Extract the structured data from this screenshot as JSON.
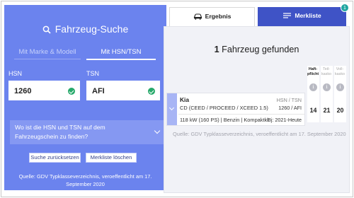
{
  "search": {
    "title": "Fahrzeug-Suche",
    "mode_tabs": [
      "Mit Marke & Modell",
      "Mit HSN/TSN"
    ],
    "active_mode": "Mit HSN/TSN",
    "hsn_label": "HSN",
    "hsn_value": "1260",
    "tsn_label": "TSN",
    "tsn_value": "AFI",
    "faq_text": "Wo ist die HSN und TSN auf dem Fahrzeugschein zu finden?",
    "reset_button": "Suche zurücksetzen",
    "clear_button": "Merkliste löschen",
    "source_note": "Quelle: GDV Typklasseverzeichnis, veroeffentlicht am 17. September 2020"
  },
  "tabs": {
    "result_label": "Ergebnis",
    "watchlist_label": "Merkliste",
    "watchlist_count": "1"
  },
  "result": {
    "count_number": "1",
    "count_text": "Fahrzeug gefunden",
    "columns": [
      {
        "label": "Haft-pflicht",
        "active": true
      },
      {
        "label": "Teil-kasko",
        "active": false
      },
      {
        "label": "Voll-kasko",
        "active": false
      }
    ],
    "info_glyph": "i",
    "vehicle": {
      "make": "Kia",
      "model": "CD (CEED / PROCEED / XCEED 1.5)",
      "hsn_tsn_label": "HSN / TSN",
      "hsn_tsn_value": "1260 / AFI",
      "specs": "118 kW (160 PS) | Benzin | Kompaktkl",
      "build_years": "Bj: 2021-Heute",
      "scores": [
        "14",
        "21",
        "20"
      ]
    },
    "source_note": "Quelle: GDV Typklasseverzeichnis, veroeffentlicht am 17. September 2020"
  },
  "colors": {
    "left_panel": "#6b83ee",
    "watchlist_tab": "#3f53c6",
    "badge": "#1fa6a0",
    "check": "#27a96b"
  },
  "icons": [
    "search-icon",
    "check-icon",
    "chevron-down-icon",
    "car-icon",
    "list-icon",
    "info-icon"
  ]
}
